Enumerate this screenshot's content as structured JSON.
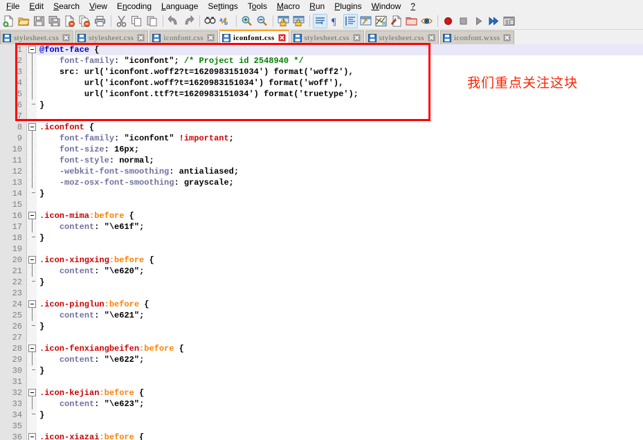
{
  "window": {
    "app": "Notepad++"
  },
  "menubar": {
    "items": [
      {
        "label": "File",
        "accel": "F"
      },
      {
        "label": "Edit",
        "accel": "E"
      },
      {
        "label": "Search",
        "accel": "S"
      },
      {
        "label": "View",
        "accel": "V"
      },
      {
        "label": "Encoding",
        "accel": "n"
      },
      {
        "label": "Language",
        "accel": "L"
      },
      {
        "label": "Settings",
        "accel": "t"
      },
      {
        "label": "Tools",
        "accel": "o"
      },
      {
        "label": "Macro",
        "accel": "M"
      },
      {
        "label": "Run",
        "accel": "R"
      },
      {
        "label": "Plugins",
        "accel": "P"
      },
      {
        "label": "Window",
        "accel": "W"
      },
      {
        "label": "?",
        "accel": "?"
      }
    ]
  },
  "toolbar": {
    "buttons": [
      {
        "name": "new-file-icon",
        "title": "New"
      },
      {
        "name": "open-file-icon",
        "title": "Open"
      },
      {
        "name": "save-icon",
        "title": "Save"
      },
      {
        "name": "save-all-icon",
        "title": "Save All"
      },
      {
        "name": "close-file-icon",
        "title": "Close"
      },
      {
        "name": "close-all-icon",
        "title": "Close All"
      },
      {
        "name": "print-icon",
        "title": "Print"
      },
      {
        "name": "separator-1",
        "title": ""
      },
      {
        "name": "cut-icon",
        "title": "Cut"
      },
      {
        "name": "copy-icon",
        "title": "Copy"
      },
      {
        "name": "paste-icon",
        "title": "Paste"
      },
      {
        "name": "separator-2",
        "title": ""
      },
      {
        "name": "undo-icon",
        "title": "Undo"
      },
      {
        "name": "redo-icon",
        "title": "Redo"
      },
      {
        "name": "separator-3",
        "title": ""
      },
      {
        "name": "find-icon",
        "title": "Find"
      },
      {
        "name": "replace-icon",
        "title": "Replace"
      },
      {
        "name": "separator-4",
        "title": ""
      },
      {
        "name": "zoom-in-icon",
        "title": "Zoom In"
      },
      {
        "name": "zoom-out-icon",
        "title": "Zoom Out"
      },
      {
        "name": "separator-5",
        "title": ""
      },
      {
        "name": "sync-vertical-icon",
        "title": "Synchronize Vertical Scrolling"
      },
      {
        "name": "sync-horizontal-icon",
        "title": "Synchronize Horizontal Scrolling"
      },
      {
        "name": "separator-6",
        "title": ""
      },
      {
        "name": "word-wrap-icon",
        "title": "Word wrap"
      },
      {
        "name": "show-all-chars-icon",
        "title": "Show All Characters"
      },
      {
        "name": "indent-guide-icon",
        "title": "Show Indent Guide"
      },
      {
        "name": "user-defined-dialog-icon",
        "title": "User Defined Dialogue"
      },
      {
        "name": "document-map-icon",
        "title": "Document Map"
      },
      {
        "name": "function-list-icon",
        "title": "Function List"
      },
      {
        "name": "folder-as-workspace-icon",
        "title": "Folder as Workspace"
      },
      {
        "name": "monitoring-icon",
        "title": "Monitoring"
      },
      {
        "name": "separator-7",
        "title": ""
      },
      {
        "name": "record-macro-icon",
        "title": "Start Recording"
      },
      {
        "name": "stop-macro-icon",
        "title": "Stop Recording"
      },
      {
        "name": "play-macro-icon",
        "title": "Playback"
      },
      {
        "name": "run-macro-multiple-icon",
        "title": "Run a Macro Multiple Times"
      },
      {
        "name": "save-macro-icon",
        "title": "Save Current Recorded Macro"
      }
    ]
  },
  "tabs": [
    {
      "label": "stylesheet.css",
      "active": false,
      "modified": false
    },
    {
      "label": "stylesheet.css",
      "active": false,
      "modified": false
    },
    {
      "label": "iconfont.css",
      "active": false,
      "modified": false
    },
    {
      "label": "iconfont.css",
      "active": true,
      "modified": true
    },
    {
      "label": "stylesheet.css",
      "active": false,
      "modified": false
    },
    {
      "label": "stylesheet.css",
      "active": false,
      "modified": false
    },
    {
      "label": "iconfont.wxss",
      "active": false,
      "modified": false
    }
  ],
  "annotation": {
    "text": "我们重点关注这块",
    "color": "#ff2200",
    "box_color": "#ff0000"
  },
  "editor": {
    "language": "CSS",
    "first_visible_line": 1,
    "lines": [
      {
        "num": 1,
        "text": "@font-face {"
      },
      {
        "num": 2,
        "text": "    font-family: \"iconfont\"; /* Project id 2548940 */"
      },
      {
        "num": 3,
        "text": "    src: url('iconfont.woff2?t=1620983151034') format('woff2'),"
      },
      {
        "num": 4,
        "text": "         url('iconfont.woff?t=1620983151034') format('woff'),"
      },
      {
        "num": 5,
        "text": "         url('iconfont.ttf?t=1620983151034') format('truetype');"
      },
      {
        "num": 6,
        "text": "}"
      },
      {
        "num": 7,
        "text": ""
      },
      {
        "num": 8,
        "text": ".iconfont {"
      },
      {
        "num": 9,
        "text": "    font-family: \"iconfont\" !important;"
      },
      {
        "num": 10,
        "text": "    font-size: 16px;"
      },
      {
        "num": 11,
        "text": "    font-style: normal;"
      },
      {
        "num": 12,
        "text": "    -webkit-font-smoothing: antialiased;"
      },
      {
        "num": 13,
        "text": "    -moz-osx-font-smoothing: grayscale;"
      },
      {
        "num": 14,
        "text": "}"
      },
      {
        "num": 15,
        "text": ""
      },
      {
        "num": 16,
        "text": ".icon-mima:before {"
      },
      {
        "num": 17,
        "text": "    content: \"\\e61f\";"
      },
      {
        "num": 18,
        "text": "}"
      },
      {
        "num": 19,
        "text": ""
      },
      {
        "num": 20,
        "text": ".icon-xingxing:before {"
      },
      {
        "num": 21,
        "text": "    content: \"\\e620\";"
      },
      {
        "num": 22,
        "text": "}"
      },
      {
        "num": 23,
        "text": ""
      },
      {
        "num": 24,
        "text": ".icon-pinglun:before {"
      },
      {
        "num": 25,
        "text": "    content: \"\\e621\";"
      },
      {
        "num": 26,
        "text": "}"
      },
      {
        "num": 27,
        "text": ""
      },
      {
        "num": 28,
        "text": ".icon-fenxiangbeifen:before {"
      },
      {
        "num": 29,
        "text": "    content: \"\\e622\";"
      },
      {
        "num": 30,
        "text": "}"
      },
      {
        "num": 31,
        "text": ""
      },
      {
        "num": 32,
        "text": ".icon-kejian:before {"
      },
      {
        "num": 33,
        "text": "    content: \"\\e623\";"
      },
      {
        "num": 34,
        "text": "}"
      },
      {
        "num": 35,
        "text": ""
      },
      {
        "num": 36,
        "text": ".icon-xiazai:before {"
      }
    ]
  }
}
